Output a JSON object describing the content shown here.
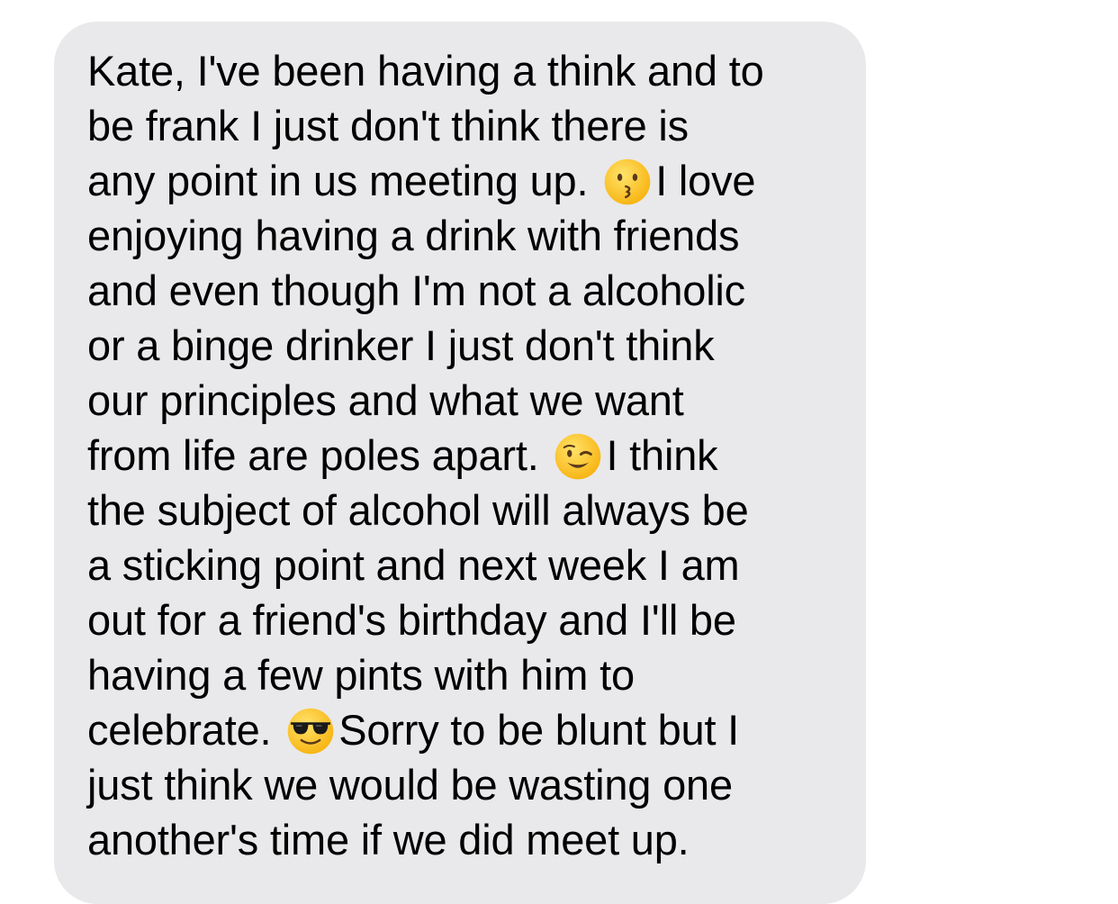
{
  "message": {
    "line1": "Kate, I've been having a think and to",
    "line2": "be frank I just don't think there is",
    "line3_before": "any point in us meeting up. ",
    "line3_after": "I love",
    "line4": "enjoying having a drink with friends",
    "line5": "and even though I'm not a alcoholic",
    "line6": "or a binge drinker I just don't think",
    "line7": "our principles and what we want",
    "line8_before": "from life are poles apart. ",
    "line8_after": "I think",
    "line9": "the subject of alcohol will always be",
    "line10": "a sticking point and next week I am",
    "line11": "out for a friend's birthday and I'll be",
    "line12": "having a few pints with him to",
    "line13_before": "celebrate. ",
    "line13_after": "Sorry to be blunt but I",
    "line14": "just think we would be wasting one",
    "line15": "another's time if we did meet up.",
    "emojis": [
      "kissing-face-icon",
      "winking-face-icon",
      "sunglasses-face-icon"
    ]
  },
  "colors": {
    "bubble": "#e9e9eb",
    "text": "#000000",
    "emoji_yellow": "#fcc21b"
  }
}
